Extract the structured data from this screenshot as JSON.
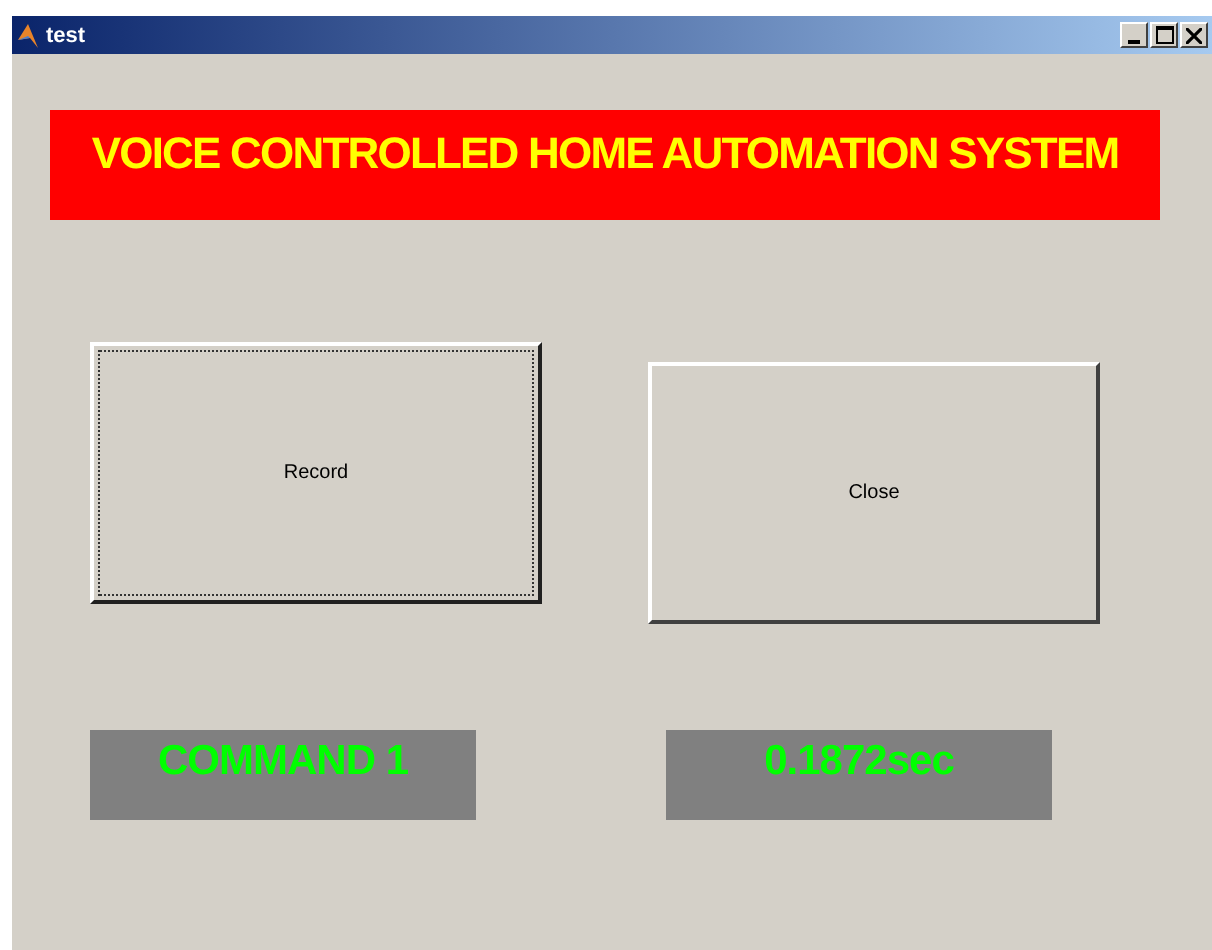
{
  "window": {
    "title": "test"
  },
  "banner": {
    "text": "VOICE CONTROLLED HOME AUTOMATION SYSTEM"
  },
  "buttons": [
    {
      "label": "Record",
      "focused": true
    },
    {
      "label": "Close",
      "focused": false
    }
  ],
  "displays": [
    {
      "text": "COMMAND 1"
    },
    {
      "text": "0.1872sec"
    }
  ]
}
